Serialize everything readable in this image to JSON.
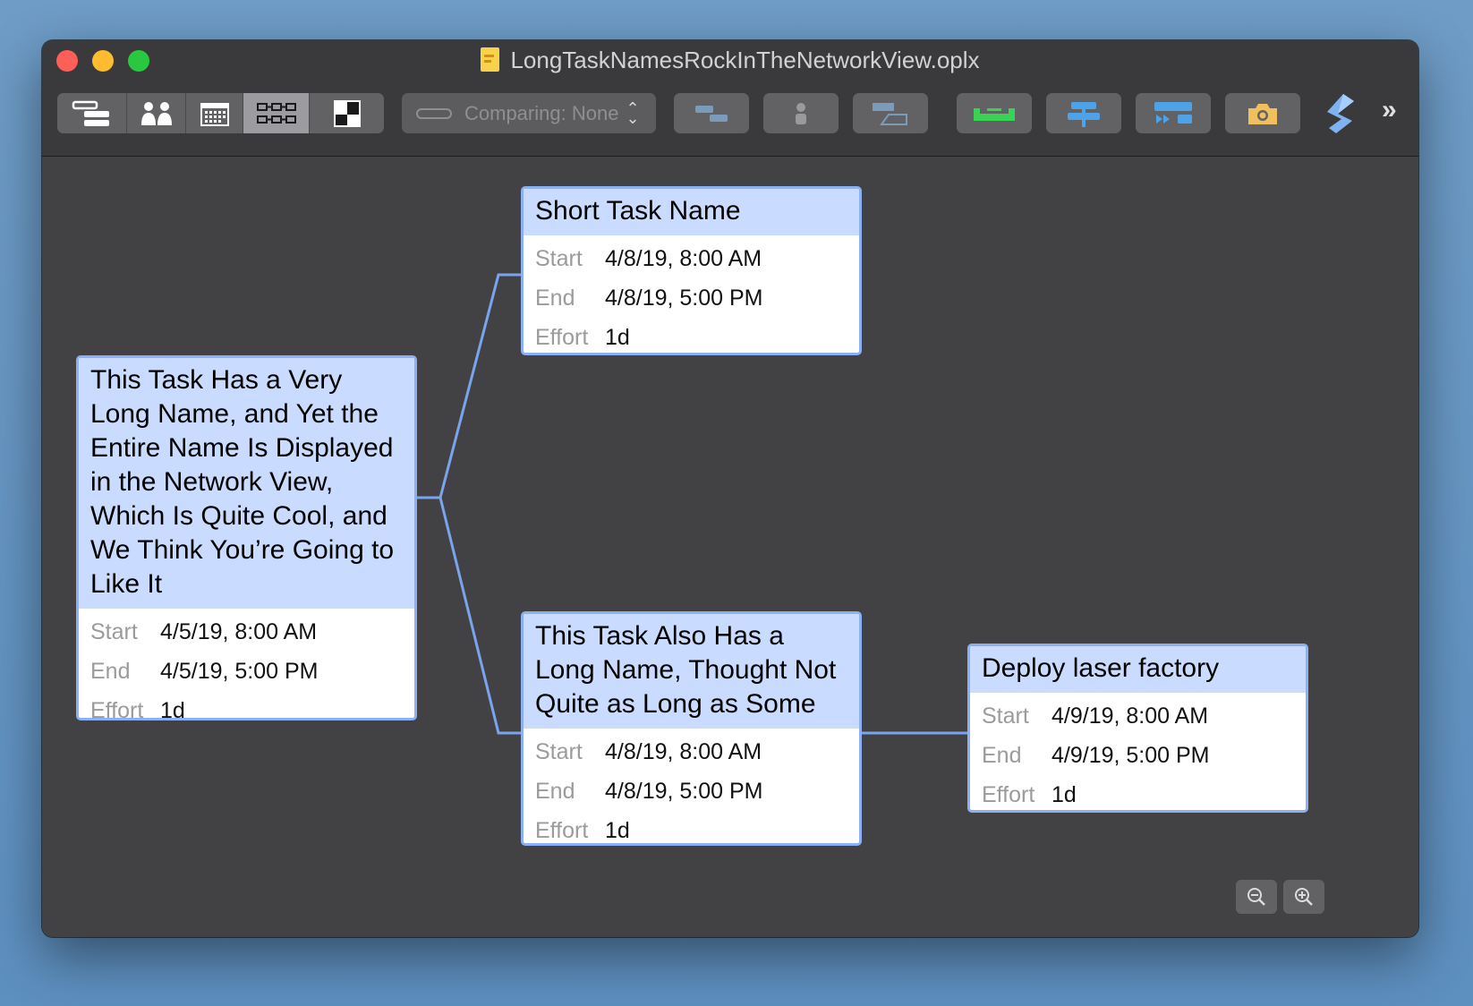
{
  "window": {
    "title": "LongTaskNamesRockInTheNetworkView.oplx"
  },
  "toolbar": {
    "view_segments": [
      {
        "name": "gantt-view-icon",
        "active": false
      },
      {
        "name": "resources-view-icon",
        "active": false
      },
      {
        "name": "calendar-view-icon",
        "active": false
      },
      {
        "name": "network-view-icon",
        "active": true
      },
      {
        "name": "dashboard-view-icon",
        "active": false
      }
    ],
    "compare_label": "Comparing: None",
    "buttons": [
      "add-task-icon",
      "add-resource-icon",
      "add-milestone-icon",
      "level-resources-icon",
      "reschedule-icon",
      "catch-up-icon",
      "snapshot-camera-icon",
      "omni-automation-icon",
      "overflow-chevron-icon"
    ],
    "overflow_label": "»"
  },
  "network": {
    "field_labels": {
      "start": "Start",
      "end": "End",
      "effort": "Effort"
    },
    "tasks": [
      {
        "name": "This Task Has a Very Long Name, and Yet the Entire Name Is Displayed in the Network View, Which Is Quite Cool, and We Think You’re Going to Like It",
        "start": "4/5/19, 8:00 AM",
        "end": "4/5/19, 5:00 PM",
        "effort": "1d"
      },
      {
        "name": "Short Task Name",
        "start": "4/8/19, 8:00 AM",
        "end": "4/8/19, 5:00 PM",
        "effort": "1d"
      },
      {
        "name": "This Task Also Has a Long Name, Thought Not Quite as Long as Some",
        "start": "4/8/19, 8:00 AM",
        "end": "4/8/19, 5:00 PM",
        "effort": "1d"
      },
      {
        "name": "Deploy laser factory",
        "start": "4/9/19, 8:00 AM",
        "end": "4/9/19, 5:00 PM",
        "effort": "1d"
      }
    ]
  },
  "colors": {
    "node_header": "#c9dcff",
    "node_border": "#8bb1f3",
    "connector": "#7aa4ee",
    "canvas": "#424244",
    "level_icon": "#39d353",
    "blue_icon": "#4ea3e8",
    "camera_icon": "#f0c060"
  },
  "zoom_controls": [
    "zoom-out-icon",
    "zoom-in-icon"
  ]
}
